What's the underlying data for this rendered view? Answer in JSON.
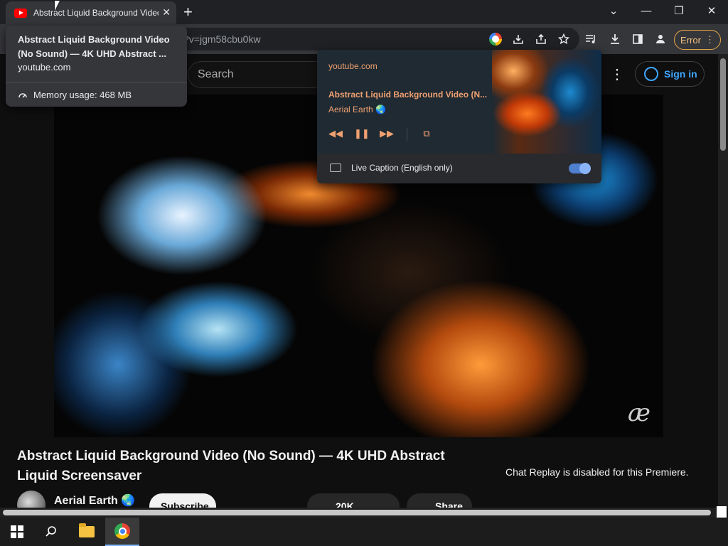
{
  "browser": {
    "tab_title": "Abstract Liquid Background Video",
    "tab_close": "✕",
    "new_tab": "+",
    "url_visible": "?v=jgm58cbu0kw",
    "error_label": "Error",
    "window_controls": {
      "dropdown": "⌄",
      "minimize": "—",
      "restore": "❐",
      "close": "✕"
    }
  },
  "hover_card": {
    "title": "Abstract Liquid Background Video (No Sound) — 4K UHD Abstract ...",
    "domain": "youtube.com",
    "memory": "Memory usage: 468 MB"
  },
  "media_popup": {
    "site": "youtube.com",
    "title": "Abstract Liquid Background Video (N...",
    "artist": "Aerial Earth 🌏",
    "controls": {
      "prev": "◀◀",
      "pause": "❚❚",
      "next": "▶▶",
      "pip": "⧉"
    },
    "live_caption": "Live Caption (English only)",
    "live_caption_on": true
  },
  "youtube": {
    "search_placeholder": "Search",
    "sign_in": "Sign in",
    "kebab": "⋮",
    "watermark": "æ",
    "video_title": "Abstract Liquid Background Video (No Sound) — 4K UHD Abstract Liquid Screensaver",
    "channel_name": "Aerial Earth 🌏",
    "subscribe_label": "Subscribe",
    "likes": "20K",
    "share_label": "Share",
    "chat_replay": "Chat Replay is disabled for this Premiere."
  },
  "taskbar": {
    "items": [
      "start",
      "search",
      "file-explorer",
      "chrome"
    ]
  },
  "colors": {
    "accent_blue": "#3ea6ff",
    "media_text": "#f0a070",
    "error_border": "#e8a945"
  }
}
